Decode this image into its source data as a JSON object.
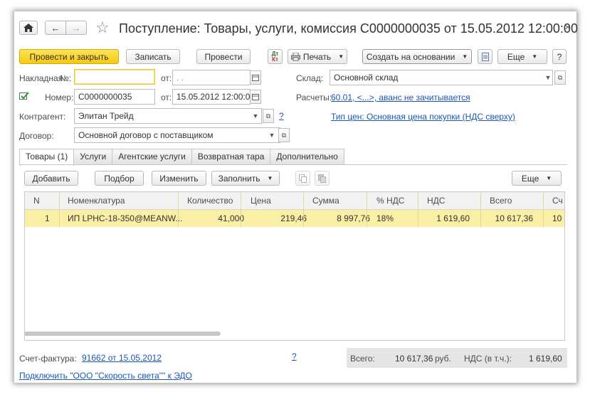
{
  "header": {
    "title": "Поступление: Товары, услуги, комиссия С0000000035 от 15.05.2012 12:00:00",
    "close_glyph": "×",
    "home_icon": "home-icon",
    "back_glyph": "←",
    "forward_glyph": "→",
    "star_glyph": "☆"
  },
  "toolbar": {
    "post_close": "Провести и закрыть",
    "save": "Записать",
    "post": "Провести",
    "dtkt_top": "Дт",
    "dtkt_bottom": "Кт",
    "print": "Печать",
    "create_based": "Создать на основании",
    "more": "Еще",
    "help": "?"
  },
  "form": {
    "invoice_label": "Накладная",
    "no_label": "№:",
    "invoice_number": "",
    "from_label": "от:",
    "invoice_date": " .  .",
    "number_label": "Номер:",
    "number_value": "С0000000035",
    "date_value": "15.05.2012 12:00:00",
    "warehouse_label": "Склад:",
    "warehouse_value": "Основной склад",
    "settlements_label": "Расчеты:",
    "settlements_link": "60.01, <...>, аванс не зачитывается",
    "counterparty_label": "Контрагент:",
    "counterparty_value": "Элитан Трейд",
    "question": "?",
    "price_type_link": "Тип цен: Основная цена покупки (НДС сверху)",
    "contract_label": "Договор:",
    "contract_value": "Основной договор с поставщиком"
  },
  "tabs": [
    "Товары (1)",
    "Услуги",
    "Агентские услуги",
    "Возвратная тара",
    "Дополнительно"
  ],
  "table_toolbar": {
    "add": "Добавить",
    "pick": "Подбор",
    "edit": "Изменить",
    "fill": "Заполнить",
    "more": "Еще"
  },
  "table": {
    "headers": [
      "N",
      "Номенклатура",
      "Количество",
      "Цена",
      "Сумма",
      "% НДС",
      "НДС",
      "Всего",
      "Сч"
    ],
    "rows": [
      [
        "1",
        "ИП LPHC-18-350@MEANW...",
        "41,000",
        "219,46",
        "8 997,76",
        "18%",
        "1 619,60",
        "10 617,36",
        "10"
      ]
    ]
  },
  "footer": {
    "invoice_label": "Счет-фактура:",
    "invoice_link": "91662 от 15.05.2012",
    "question": "?",
    "total_label": "Всего:",
    "total_value": "10 617,36",
    "currency": "руб.",
    "vat_label": "НДС (в т.ч.):",
    "vat_value": "1 619,60",
    "edo_link": "Подключить \"ООО \"Скорость света\"\" к ЭДО"
  },
  "colors": {
    "primary_button": "#f6c913",
    "link": "#1a56b8",
    "selected_row": "#fbefa5"
  }
}
